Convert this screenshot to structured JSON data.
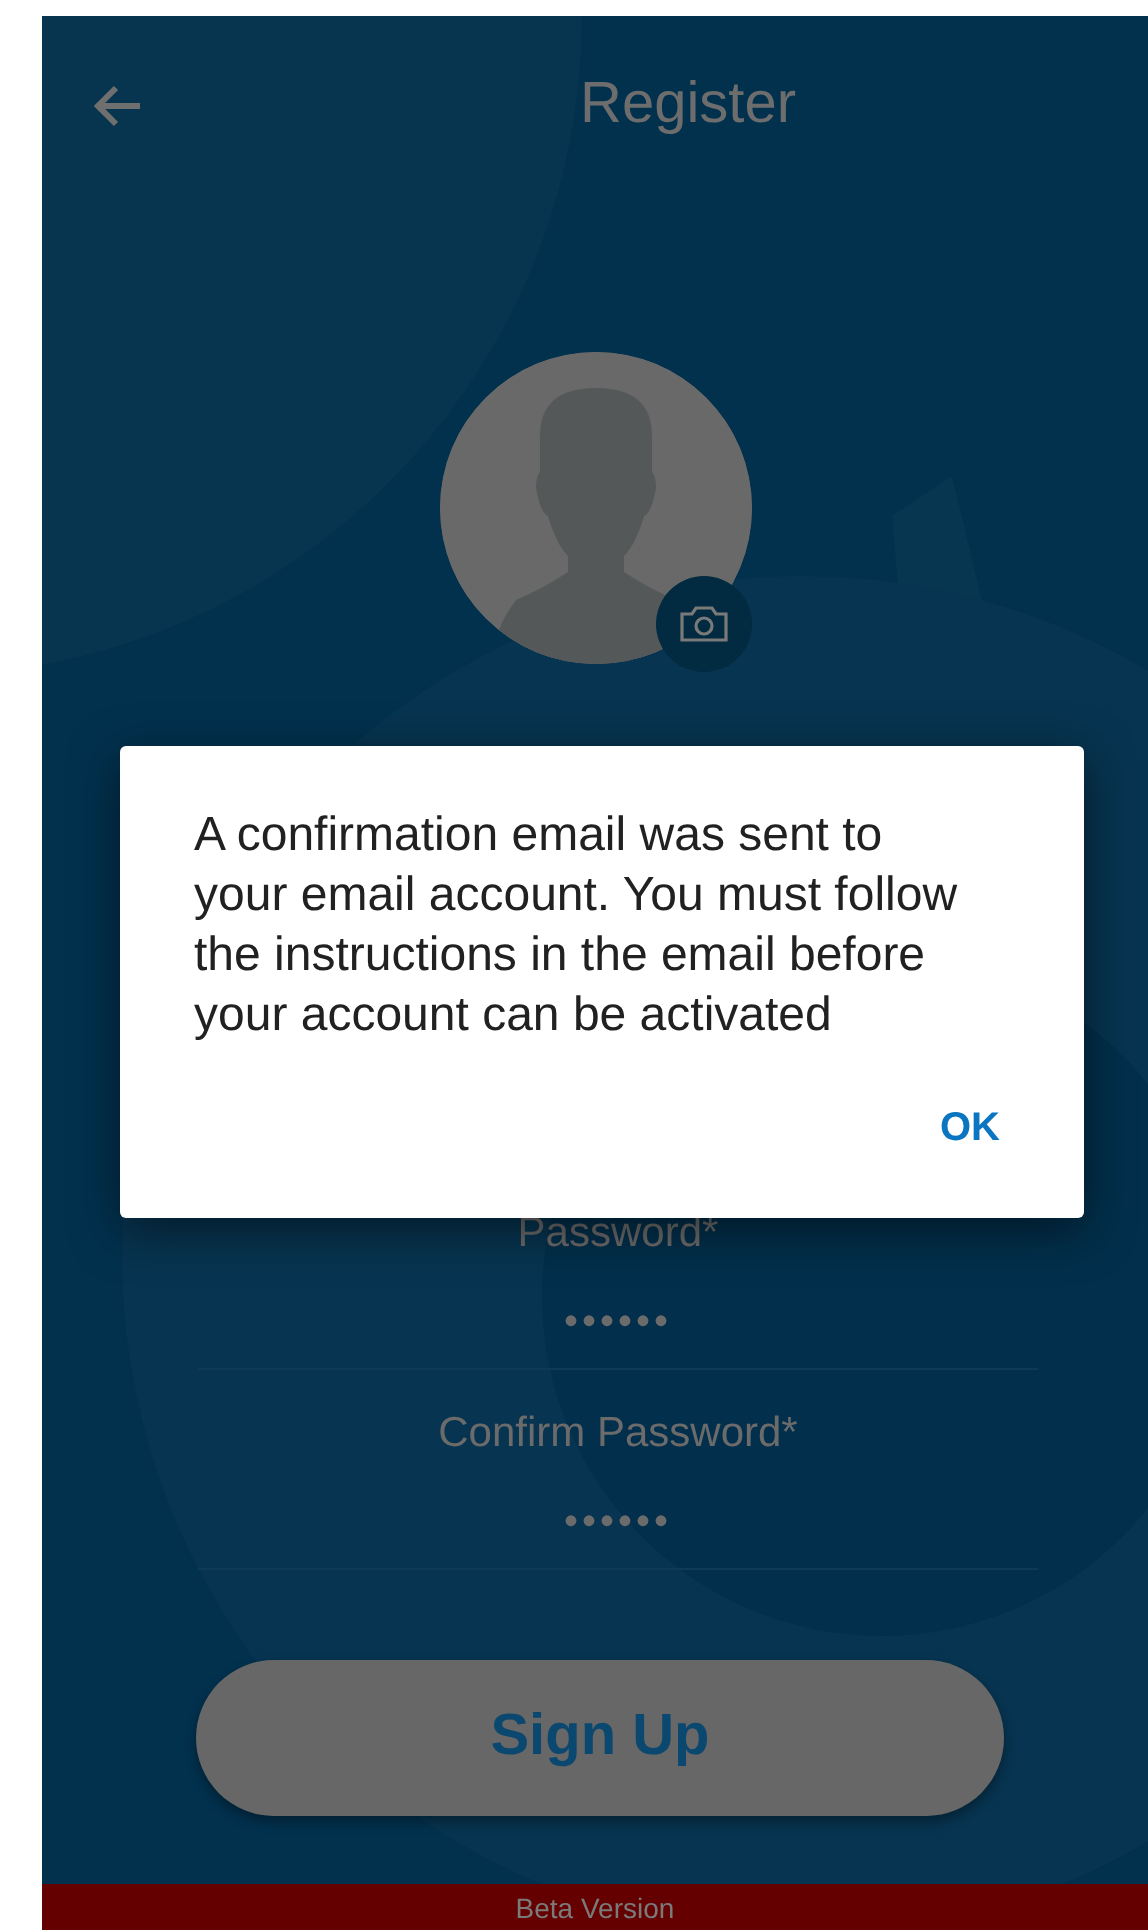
{
  "header": {
    "title": "Register"
  },
  "fields": [
    {
      "label": "Password*",
      "value": "••••••"
    },
    {
      "label": "Confirm Password*",
      "value": "••••••"
    }
  ],
  "sign_up_button": "Sign Up",
  "banner": "Beta Version",
  "dialog": {
    "message": "A confirmation email was sent to your email account. You must follow the instructions in the email before your account can be activated",
    "buttons": [
      "OK"
    ]
  }
}
